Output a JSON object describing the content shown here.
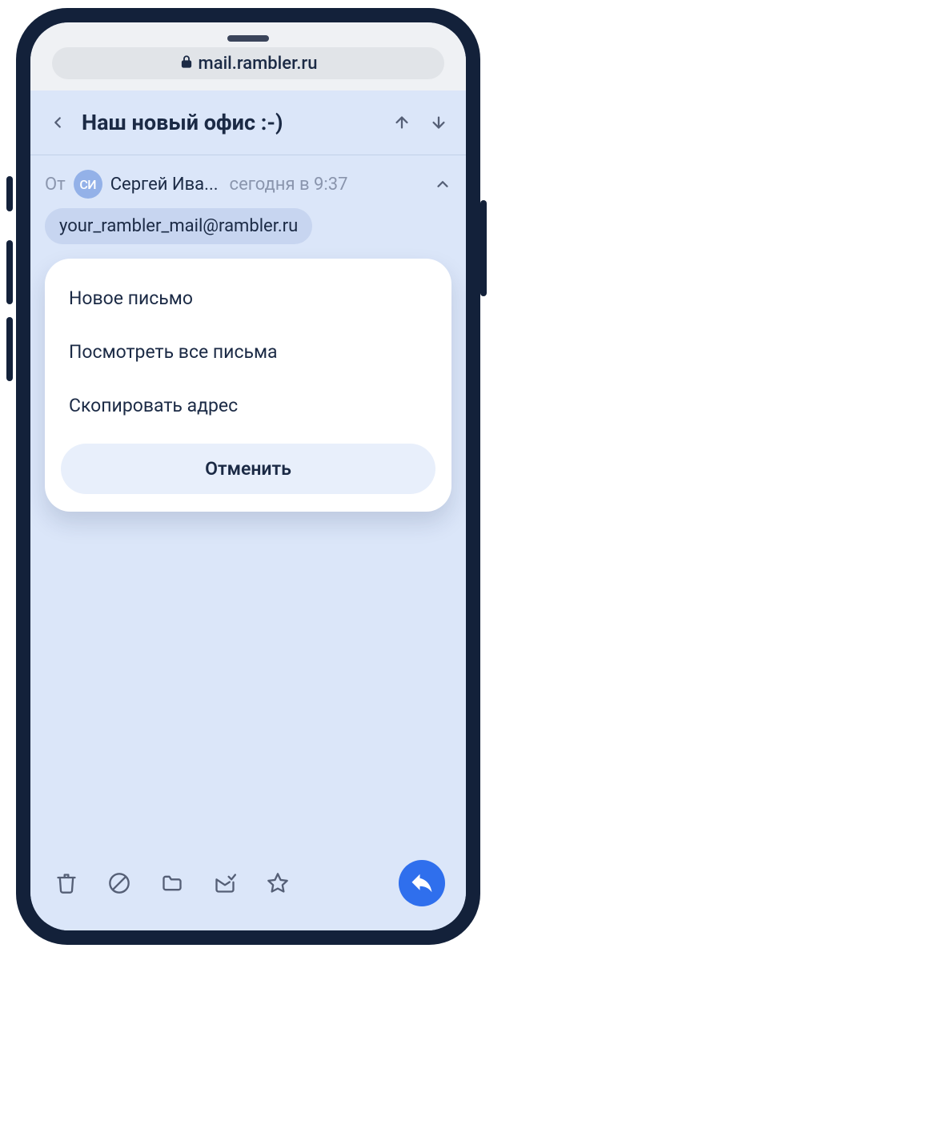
{
  "browser": {
    "url": "mail.rambler.ru"
  },
  "header": {
    "title": "Наш новый офис :-)"
  },
  "from": {
    "label": "От",
    "avatar": "СИ",
    "sender": "Сергей Ива...",
    "timestamp": "сегодня в 9:37"
  },
  "email_chip": "your_rambler_mail@rambler.ru",
  "popup": {
    "items": [
      {
        "label": "Новое письмо"
      },
      {
        "label": "Посмотреть все письма"
      },
      {
        "label": "Скопировать адрес"
      }
    ],
    "cancel": "Отменить"
  }
}
